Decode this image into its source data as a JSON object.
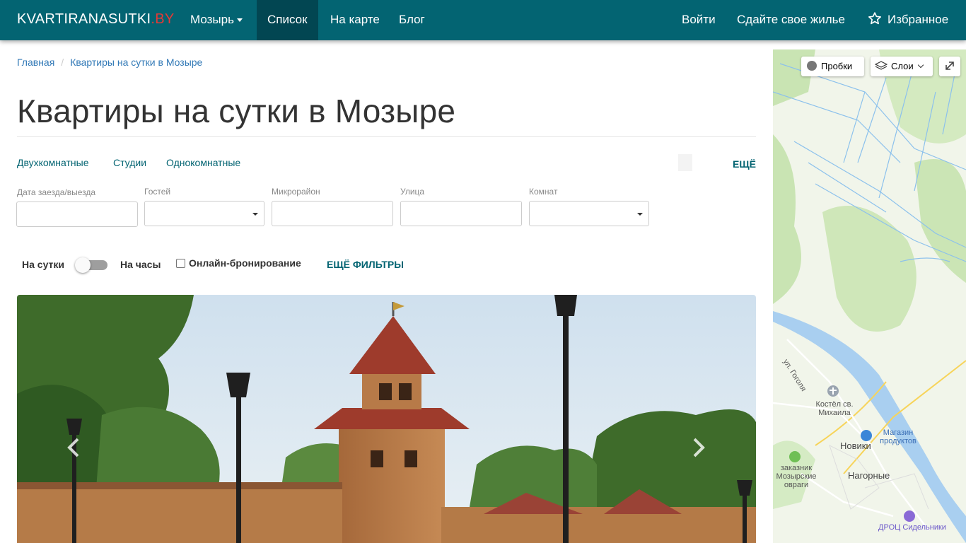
{
  "navbar": {
    "brand_main": "KVARTIRANASUTKI",
    "brand_tld": ".BY",
    "city": "Мозырь",
    "list": "Список",
    "map": "На карте",
    "blog": "Блог",
    "login": "Войти",
    "rent_out": "Сдайте свое жилье",
    "favorites": "Избранное"
  },
  "breadcrumb": {
    "home": "Главная",
    "separator": "/",
    "current": "Квартиры на сутки в Мозыре"
  },
  "page_title": "Квартиры на сутки в Мозыре",
  "quick_links": [
    "Двухкомнатные",
    "Студии",
    "Однокомнатные"
  ],
  "more_link": "ЕЩЁ",
  "filters": {
    "dates_label": "Дата заезда/выезда",
    "guests_label": "Гостей",
    "district_label": "Микрорайон",
    "street_label": "Улица",
    "rooms_label": "Комнат"
  },
  "toggle": {
    "left_label": "На сутки",
    "right_label": "На часы",
    "online_booking": "Онлайн-бронирование",
    "more_filters": "ЕЩЁ ФИЛЬТРЫ"
  },
  "map": {
    "traffic": "Пробки",
    "layers": "Слои",
    "labels": {
      "street": "ул. Гоголя",
      "church": "Костёл св. Михаила",
      "shop": "Магазин продуктов",
      "novik": "Новики",
      "reserve": "заказник Мозырские овраги",
      "nagornye": "Нагорные",
      "droc": "ДРОЦ Сидельники"
    }
  },
  "colors": {
    "navbar": "#036472",
    "navbar_active": "#024652",
    "accent_red": "#e53935",
    "link": "#337ab7"
  }
}
